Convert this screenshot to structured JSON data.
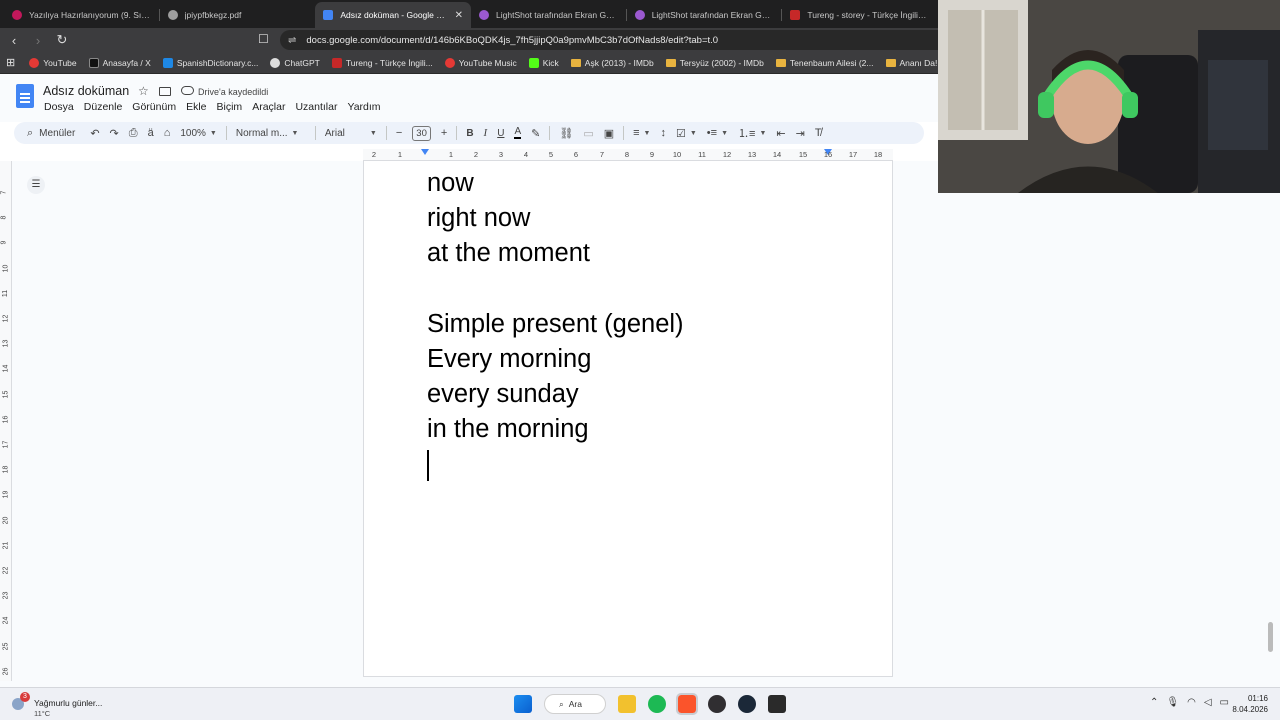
{
  "tabs": [
    {
      "label": "Yazılıya Hazırlanıyorum (9. Sınıf) OGM",
      "favicon_color": "#c2185b",
      "active": false
    },
    {
      "label": "jpiypfbkegz.pdf",
      "favicon_color": "#9e9e9e",
      "active": false
    },
    {
      "label": "Adsız doküman - Google Dokümanlar",
      "favicon_color": "#4285f4",
      "active": true,
      "close": "✕"
    },
    {
      "label": "LightShot tarafından Ekran Görüntüsü",
      "favicon_color": "#9b59d0",
      "active": false
    },
    {
      "label": "LightShot tarafından Ekran Görüntüsü",
      "favicon_color": "#9b59d0",
      "active": false
    },
    {
      "label": "Tureng - storey - Türkçe İngilizce",
      "favicon_color": "#c62828",
      "active": false
    }
  ],
  "address": {
    "url": "docs.google.com/document/d/146b6KBoQDK4js_7fh5jjipQ0a9pmvMbC3b7dOfNads8/edit?tab=t.0",
    "back": "‹",
    "forward": "›",
    "reload": "↻",
    "bookmark": "☐",
    "tune": "⇌"
  },
  "bookmarks": [
    {
      "label": "YouTube",
      "icon": "youtube-icon",
      "color": "#e53935"
    },
    {
      "label": "Anasayfa / X",
      "icon": "x-icon",
      "color": "#111111"
    },
    {
      "label": "SpanishDictionary.c...",
      "icon": "spanishdict-icon",
      "color": "#1e88e5"
    },
    {
      "label": "ChatGPT",
      "icon": "chatgpt-icon",
      "color": "#dddddd"
    },
    {
      "label": "Tureng - Türkçe İngili...",
      "icon": "tureng-icon",
      "color": "#c62828"
    },
    {
      "label": "YouTube Music",
      "icon": "youtube-music-icon",
      "color": "#e53935"
    },
    {
      "label": "Kick",
      "icon": "kick-icon",
      "color": "#53fc18"
    },
    {
      "label": "Aşk (2013) - IMDb",
      "icon": "folder-icon",
      "color": "#e8b33f"
    },
    {
      "label": "Tersyüz (2002) - IMDb",
      "icon": "folder-icon",
      "color": "#e8b33f"
    },
    {
      "label": "Tenenbaum Ailesi (2...",
      "icon": "folder-icon",
      "color": "#e8b33f"
    },
    {
      "label": "Ananı Da! (2001) - I...",
      "icon": "folder-icon",
      "color": "#e8b33f"
    }
  ],
  "docs": {
    "title": "Adsız doküman",
    "saved_status": "Drive'a kaydedildi",
    "menus": [
      "Dosya",
      "Düzenle",
      "Görünüm",
      "Ekle",
      "Biçim",
      "Araçlar",
      "Uzantılar",
      "Yardım"
    ]
  },
  "toolbar": {
    "search_label": "Menüler",
    "zoom": "100%",
    "style": "Normal m...",
    "font": "Arial",
    "font_size": "30",
    "minus": "−",
    "plus": "+",
    "bold": "B",
    "italic": "I",
    "underline": "U",
    "text_color": "A"
  },
  "ruler": {
    "labels": [
      "2",
      "1",
      "1",
      "2",
      "3",
      "4",
      "5",
      "6",
      "7",
      "8",
      "9",
      "10",
      "11",
      "12",
      "13",
      "14",
      "15",
      "16",
      "17",
      "18"
    ]
  },
  "vruler": {
    "labels": [
      "7",
      "8",
      "9",
      "10",
      "11",
      "12",
      "13",
      "14",
      "15",
      "16",
      "17",
      "18",
      "19",
      "20",
      "21",
      "22",
      "23",
      "24",
      "25",
      "26",
      "27",
      "28"
    ]
  },
  "document": {
    "lines": [
      "now",
      "right now",
      "at the moment",
      "",
      "Simple present (genel)",
      "Every morning",
      "every sunday",
      "in the morning"
    ]
  },
  "taskbar": {
    "weather_title": "Yağmurlu günler...",
    "weather_temp": "11°C",
    "weather_badge": "3",
    "search_label": "Ara",
    "time": "01:16",
    "date": "8.04.2026"
  },
  "colors": {
    "docs_blue": "#4285f4",
    "toolbar_bg": "#edf2fa",
    "browser_dark": "#3c3c3e"
  }
}
